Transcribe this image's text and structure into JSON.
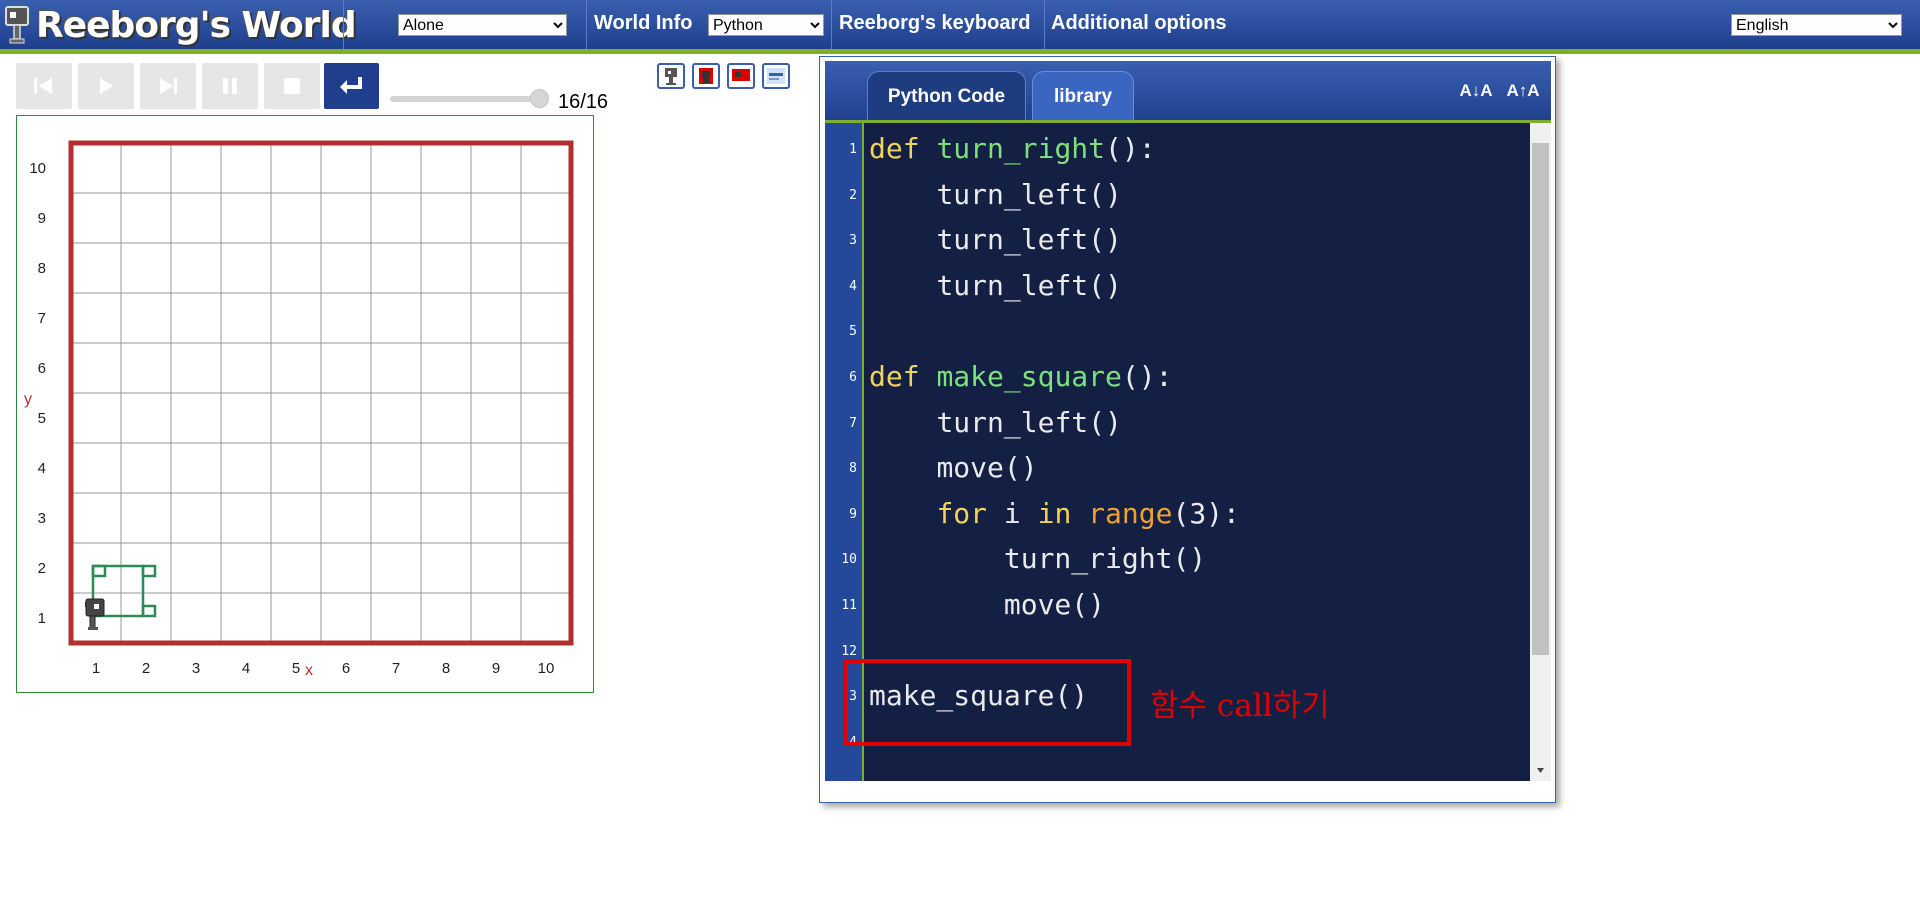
{
  "app": {
    "title": "Reeborg's World"
  },
  "header": {
    "mode_select": "Alone",
    "world_info_label": "World Info",
    "language_select": "Python",
    "keyboard_label": "Reeborg's keyboard",
    "options_label": "Additional options",
    "ui_language_select": "English"
  },
  "controls": {
    "buttons": [
      "reverse-step",
      "run",
      "step",
      "pause",
      "stop",
      "reload"
    ],
    "step_counter": "16/16"
  },
  "world": {
    "y_axis_label": "y",
    "x_axis_label": "x",
    "x_ticks": [
      "1",
      "2",
      "3",
      "4",
      "5",
      "6",
      "7",
      "8",
      "9",
      "10"
    ],
    "y_ticks": [
      "1",
      "2",
      "3",
      "4",
      "5",
      "6",
      "7",
      "8",
      "9",
      "10"
    ],
    "wall_color": "#b03030",
    "trace_color": "#2e8b57",
    "robot_position": [
      1,
      1
    ]
  },
  "editor": {
    "tabs": [
      "Python Code",
      "library"
    ],
    "active_tab": "Python Code",
    "font_decrease_label": "A↓A",
    "font_increase_label": "A↑A",
    "lines": [
      "def turn_right():",
      "    turn_left()",
      "    turn_left()",
      "    turn_left()",
      "",
      "def make_square():",
      "    turn_left()",
      "    move()",
      "    for i in range(3):",
      "        turn_right()",
      "        move()",
      "",
      "make_square()",
      ""
    ],
    "line_numbers": [
      "1",
      "2",
      "3",
      "4",
      "5",
      "6",
      "7",
      "8",
      "9",
      "10",
      "11",
      "12",
      "3",
      "4"
    ],
    "annotation": "함수 call하기"
  }
}
